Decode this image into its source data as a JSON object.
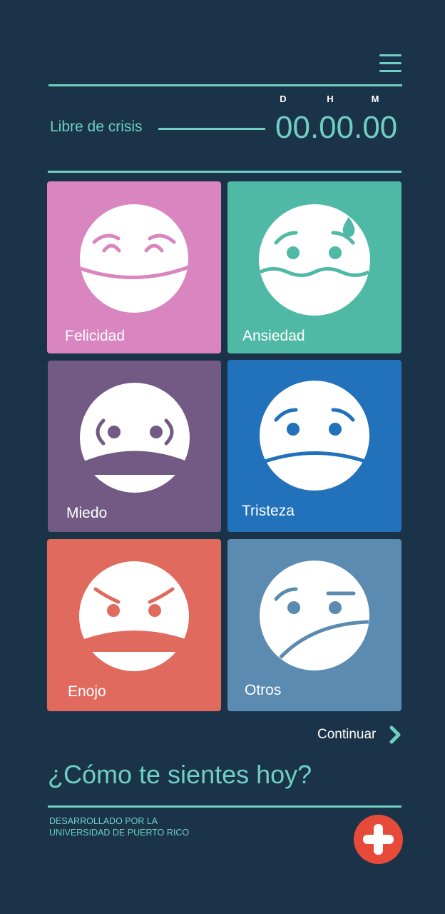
{
  "header": {
    "menu_icon": "hamburger-menu-icon"
  },
  "timer": {
    "units": [
      "D",
      "H",
      "M"
    ],
    "label": "Libre de crisis",
    "value": "00.00.00"
  },
  "emotions": [
    {
      "label": "Felicidad",
      "color": "#d985c0",
      "icon": "happy-face-icon"
    },
    {
      "label": "Ansiedad",
      "color": "#4fb9a5",
      "icon": "anxious-face-icon"
    },
    {
      "label": "Miedo",
      "color": "#725a85",
      "icon": "scared-face-icon"
    },
    {
      "label": "Tristeza",
      "color": "#2171bb",
      "icon": "sad-face-icon"
    },
    {
      "label": "Enojo",
      "color": "#e06a5e",
      "icon": "angry-face-icon"
    },
    {
      "label": "Otros",
      "color": "#5b8bb0",
      "icon": "uncertain-face-icon"
    }
  ],
  "continue": {
    "label": "Continuar",
    "icon": "chevron-right-icon"
  },
  "question": "¿Cómo te sientes hoy?",
  "footer": {
    "line1": "DESARROLLADO POR LA",
    "line2": "UNIVERSIDAD DE PUERTO RICO",
    "fab_icon": "plus-icon"
  },
  "colors": {
    "background": "#1a3349",
    "accent": "#6fcfc3",
    "fab": "#e84a3a"
  }
}
